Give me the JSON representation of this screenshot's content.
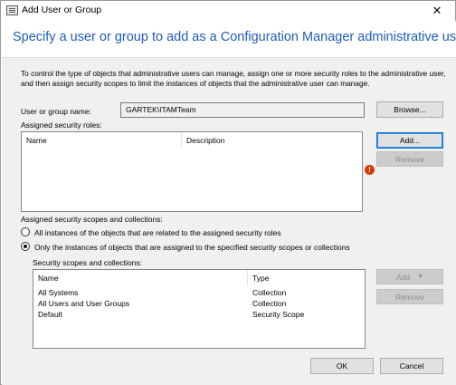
{
  "window": {
    "title": "Add User or Group",
    "close_glyph": "✕"
  },
  "header": {
    "title": "Specify a user or group to add as a Configuration Manager administrative user"
  },
  "description": "To control the type of objects that administrative users can manage, assign one or more security roles to the administrative user, and then assign security scopes to limit the instances of objects that the administrative user can manage.",
  "user_or_group": {
    "label": "User or group name:",
    "value": "GARTEK\\ITAMTeam",
    "browse_label": "Browse..."
  },
  "roles": {
    "label": "Assigned security roles:",
    "columns": [
      "Name",
      "Description"
    ],
    "rows": [],
    "add_label": "Add...",
    "remove_label": "Remove",
    "error_glyph": "!"
  },
  "scopes": {
    "label": "Assigned security scopes and collections:",
    "option_all": "All instances of the objects that are related to the assigned security roles",
    "option_only": "Only the instances of objects that are assigned to the specified security scopes or collections",
    "selected_option": "only",
    "list_label": "Security scopes and collections:",
    "columns": [
      "Name",
      "Type"
    ],
    "rows": [
      {
        "name": "All Systems",
        "type": "Collection"
      },
      {
        "name": "All Users and User Groups",
        "type": "Collection"
      },
      {
        "name": "Default",
        "type": "Security Scope"
      }
    ],
    "add_label": "Add",
    "add_arrow": "▼",
    "remove_label": "Remove"
  },
  "footer": {
    "ok_label": "OK",
    "cancel_label": "Cancel"
  },
  "colors": {
    "header_title": "#1f5db8",
    "body_background": "#f0f0f0",
    "error_icon": "#d83b01"
  },
  "icons": {
    "app": "window-icon",
    "close": "close-icon",
    "error": "error-icon",
    "dropdown": "chevron-down-icon"
  }
}
